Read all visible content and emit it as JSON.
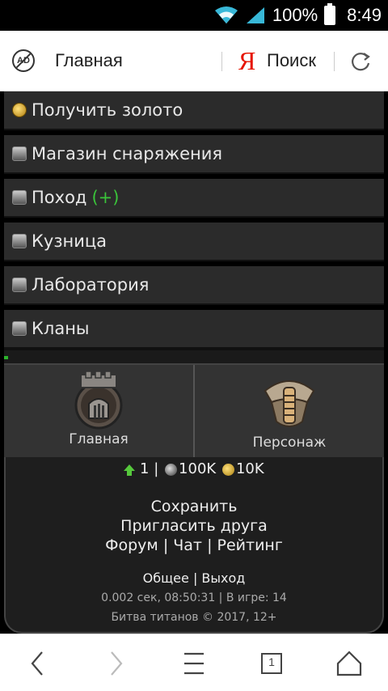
{
  "status": {
    "battery_pct": "100%",
    "time": "8:49",
    "icons": [
      "wifi-icon",
      "signal-icon",
      "battery-icon"
    ]
  },
  "browser": {
    "ad_icon_text": "AD",
    "page_title": "Главная",
    "yandex_logo": "Я",
    "search_label": "Поиск"
  },
  "menu": {
    "items": [
      {
        "label": "Получить золото",
        "icon": "gold-coin-icon",
        "plus": ""
      },
      {
        "label": "Магазин снаряжения",
        "icon": "shop-icon",
        "plus": ""
      },
      {
        "label": "Поход",
        "icon": "campaign-icon",
        "plus": "(+)"
      },
      {
        "label": "Кузница",
        "icon": "forge-icon",
        "plus": ""
      },
      {
        "label": "Лаборатория",
        "icon": "lab-icon",
        "plus": ""
      },
      {
        "label": "Кланы",
        "icon": "clans-icon",
        "plus": ""
      }
    ]
  },
  "progress": {
    "fraction": 0.01
  },
  "tiles": {
    "main_label": "Главная",
    "character_label": "Персонаж"
  },
  "resources": {
    "level": "1",
    "sep": "|",
    "silver": "100K",
    "gold": "10K"
  },
  "footer": {
    "save": "Сохранить",
    "invite": "Пригласить друга",
    "forum": "Форум",
    "chat": "Чат",
    "rating": "Рейтинг",
    "pipe": "|",
    "general": "Общее",
    "logout": "Выход",
    "stats": "0.002 сек, 08:50:31 | В игре: 14",
    "copyright": "Битва титанов © 2017, 12+"
  },
  "nav": {
    "tabs_count": "1"
  },
  "colors": {
    "accent_green": "#3ac43a",
    "yandex_red": "#e61400",
    "menu_bg": "#2b2b2b"
  }
}
